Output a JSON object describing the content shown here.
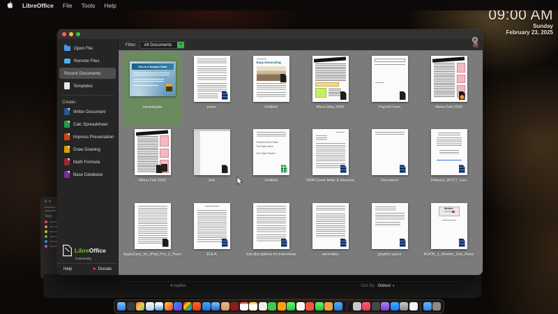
{
  "menu_bar": {
    "app_name": "LibreOffice",
    "items": [
      "File",
      "Tools",
      "Help"
    ]
  },
  "clock": {
    "time": "09:00 AM",
    "day": "Sunday",
    "date": "February 23, 2025"
  },
  "start_center": {
    "filter_label": "Filter:",
    "filter_value": "All Documents",
    "sidebar": {
      "nav": [
        {
          "label": "Open File"
        },
        {
          "label": "Remote Files"
        },
        {
          "label": "Recent Documents",
          "selected": true
        },
        {
          "label": "Templates"
        }
      ],
      "create_label": "Create:",
      "create": [
        {
          "label": "Writer Document",
          "color": "#2a5699"
        },
        {
          "label": "Calc Spreadsheet",
          "color": "#1e9e48"
        },
        {
          "label": "Impress Presentation",
          "color": "#d0440b"
        },
        {
          "label": "Draw Drawing",
          "color": "#d8a100"
        },
        {
          "label": "Math Formula",
          "color": "#a3262c"
        },
        {
          "label": "Base Database",
          "color": "#7a2ea0"
        }
      ],
      "logo": {
        "libre": "Libre",
        "office": "Office",
        "community": "Community"
      },
      "help_label": "Help",
      "donate_label": "Donate"
    },
    "documents": [
      {
        "label": "samplepptx",
        "selected": true
      },
      {
        "label": "jokes"
      },
      {
        "label": "Untitled"
      },
      {
        "label": "Menu May 2005"
      },
      {
        "label": "Payroll Form"
      },
      {
        "label": "Menu Feb 2005"
      },
      {
        "label": "Menu Feb 2005"
      },
      {
        "label": "test"
      },
      {
        "label": "Untitled"
      },
      {
        "label": "2008 Cover letter & Resume"
      },
      {
        "label": "Document"
      },
      {
        "label": "Roberts_WTC7_Lies"
      },
      {
        "label": "AppleCare_for_iPad_Pro_2_Years"
      },
      {
        "label": "EULA"
      },
      {
        "label": "Job discriptions for interviews"
      },
      {
        "label": "amenities"
      },
      {
        "label": "graphic specs"
      },
      {
        "label": "BOOK_1_Murder_Sub_Rosa"
      }
    ],
    "thumb_text": {
      "sample_slide": "This is a Sample Slide",
      "easy_decorating": "Easy Decorating",
      "numbers_l1": "Numbers Sheet Name",
      "numbers_l2": "First Table Name",
      "numbers_l3": "First Table Preview",
      "murder_l1": "Murder",
      "murder_l2": "Sub Rosa"
    },
    "selected_color": "#6b8a5e"
  },
  "background_window": {
    "replies": "4 replies",
    "sort_label": "Sort By:",
    "sort_value": "Oldest"
  },
  "tags_panel": {
    "label": "Tags",
    "colors": [
      "#ff5257",
      "#f7a23b",
      "#f7ce45",
      "#63c764",
      "#3b99fc",
      "#b26ee0"
    ]
  },
  "dock": {
    "items": [
      {
        "name": "finder-icon",
        "bg": "linear-gradient(180deg,#7ec0f8,#2d7de2)"
      },
      {
        "name": "launchpad-icon",
        "bg": "#3a3a3e"
      },
      {
        "name": "mission-control-icon",
        "bg": "linear-gradient(135deg,#f26b6b,#f2c94c 50%,#6cc56f)"
      },
      {
        "name": "preview-icon",
        "bg": "linear-gradient(180deg,#f8fafc,#aecdf0)"
      },
      {
        "name": "safari-icon",
        "bg": "linear-gradient(180deg,#eef6ff 30%,#3b9df5)"
      },
      {
        "name": "firefox-icon",
        "bg": "linear-gradient(135deg,#ffd43b,#ff7139 60%,#e3306e)"
      },
      {
        "name": "firefox-developer-icon",
        "bg": "linear-gradient(135deg,#00b3f4,#7542e5 70%)"
      },
      {
        "name": "chrome-icon",
        "bg": "linear-gradient(135deg,#ea4335 25%,#fbbc05 25% 50%,#34a853 50% 75%,#4285f4 75%)"
      },
      {
        "name": "brave-icon",
        "bg": "linear-gradient(180deg,#ff651f,#e23b1c)"
      },
      {
        "name": "mail-icon",
        "bg": "linear-gradient(180deg,#3fa9f5,#1d74e0)"
      },
      {
        "name": "tv-app-icon",
        "bg": "linear-gradient(180deg,#6fb3f0 20%,#2a66c8)"
      },
      {
        "name": "folder-app-icon",
        "bg": "linear-gradient(180deg,#e0bd8a,#caa063)"
      },
      {
        "name": "font-book-icon",
        "bg": "#8c1d22"
      },
      {
        "name": "calendar-icon",
        "bg": "linear-gradient(180deg,#f55 22%,#fbfbfb 22%)"
      },
      {
        "name": "notes-icon",
        "bg": "linear-gradient(180deg,#ffd84d 26%,#fdfdf7 26%)"
      },
      {
        "name": "textedit-icon",
        "bg": "#ededed"
      },
      {
        "name": "app-green-icon",
        "bg": "#41c94f"
      },
      {
        "name": "app-orange-icon",
        "bg": "#ff9f0a"
      },
      {
        "name": "messages-icon",
        "bg": "linear-gradient(180deg,#6bf273,#20ca3e)"
      },
      {
        "name": "photos-icon",
        "bg": "#f7f7f7"
      },
      {
        "name": "app-red-icon",
        "bg": "#f4543c"
      },
      {
        "name": "facetime-icon",
        "bg": "linear-gradient(180deg,#67ef71,#1dc93a)"
      },
      {
        "name": "app-amber-icon",
        "bg": "#f0a23a"
      },
      {
        "name": "weather-icon",
        "bg": "linear-gradient(180deg,#54a8f2,#1f7ce8)"
      },
      {
        "name": "netflix-icon",
        "bg": "linear-gradient(100deg,#16161a 45%,#e50914 50%,#16161a 56%)"
      },
      {
        "name": "compass-icon",
        "bg": "#c3c8cf"
      },
      {
        "name": "music-icon",
        "bg": "linear-gradient(180deg,#fb5c74,#e6355f)"
      },
      {
        "name": "utility-dark-icon",
        "bg": "#45484e"
      },
      {
        "name": "contacts-icon",
        "bg": "linear-gradient(180deg,#b07df0,#7d3fe0)"
      },
      {
        "name": "app-store-icon",
        "bg": "linear-gradient(180deg,#41b0ff,#1a78f0)"
      },
      {
        "name": "settings-icon",
        "bg": "linear-gradient(180deg,#c8c9cd,#8a8b90)"
      },
      {
        "name": "books-icon",
        "bg": "#f4f4f4"
      },
      {
        "name": "dock-divider",
        "divider": true
      },
      {
        "name": "downloads-folder-icon",
        "bg": "linear-gradient(180deg,#66b5f8,#2e84e8)"
      },
      {
        "name": "trash-icon",
        "bg": "rgba(200,200,205,.65)"
      }
    ]
  }
}
